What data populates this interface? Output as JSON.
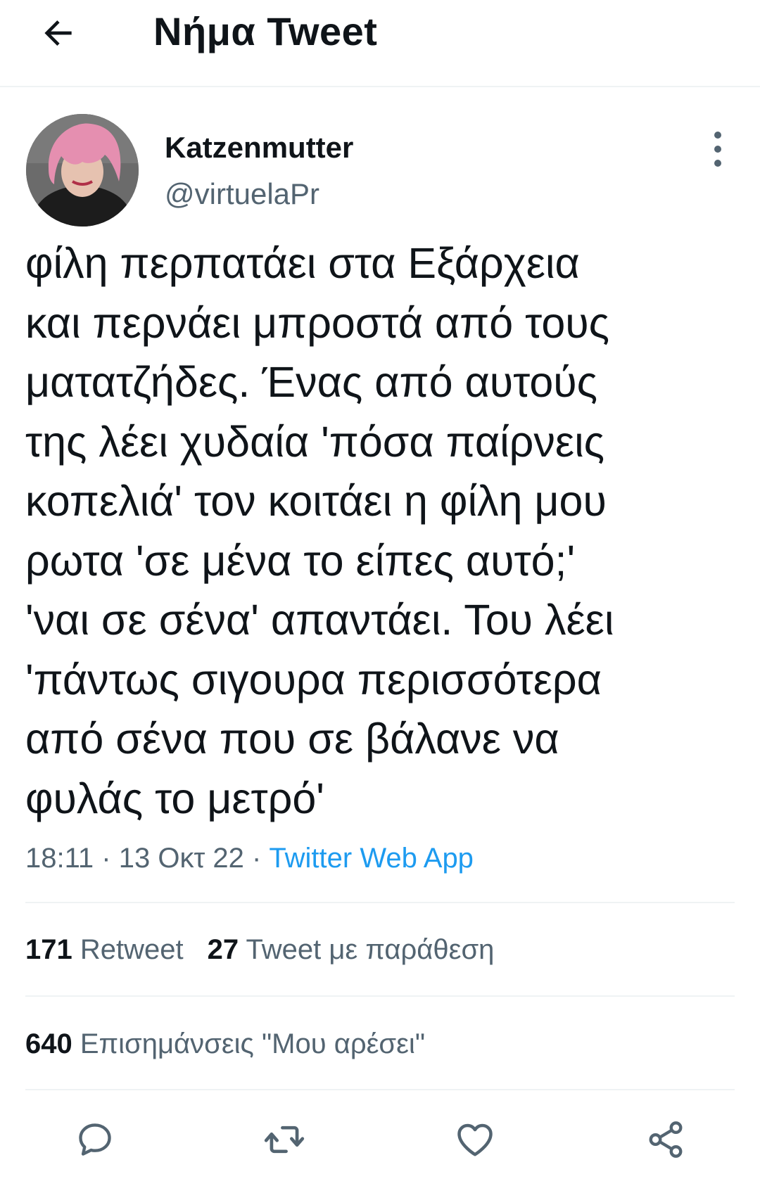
{
  "header": {
    "title": "Νήμα Tweet",
    "back_icon": "arrow-left-icon"
  },
  "tweet": {
    "author": {
      "name": "Katzenmutter",
      "handle": "@virtuelaPr",
      "avatar_colors": {
        "hair": "#e58fb0",
        "shirt": "#1c1c1c",
        "background": "#6b6b6b"
      }
    },
    "more_icon": "vertical-dots-icon",
    "text": "φίλη περπατάει στα Εξάρχεια\nκαι περνάει μπροστά από τους\nματατζήδες. Ένας από αυτούς\nτης λέει χυδαία 'πόσα παίρνεις\nκοπελιά' τον κοιτάει η φίλη μου\nρωτα 'σε μένα το είπες αυτό;'\n'ναι σε σένα' απαντάει. Του λέει\n'πάντως σιγουρα περισσότερα\nαπό σένα που σε βάλανε να\nφυλάς το μετρό'",
    "time": "18:11",
    "date": "13 Οκτ 22",
    "separator": "·",
    "source": "Twitter Web App"
  },
  "stats": {
    "retweets_count": "171",
    "retweets_label": "Retweet",
    "quotes_count": "27",
    "quotes_label": "Tweet με παράθεση",
    "likes_count": "640",
    "likes_label": "Επισημάνσεις \"Μου αρέσει\""
  },
  "actions": [
    {
      "name": "reply",
      "icon": "reply-icon"
    },
    {
      "name": "retweet",
      "icon": "retweet-icon"
    },
    {
      "name": "like",
      "icon": "heart-icon"
    },
    {
      "name": "share",
      "icon": "share-icon"
    }
  ],
  "colors": {
    "text": "#0f1419",
    "secondary": "#536471",
    "accent": "#1d9bf0",
    "divider": "#eff3f4"
  }
}
